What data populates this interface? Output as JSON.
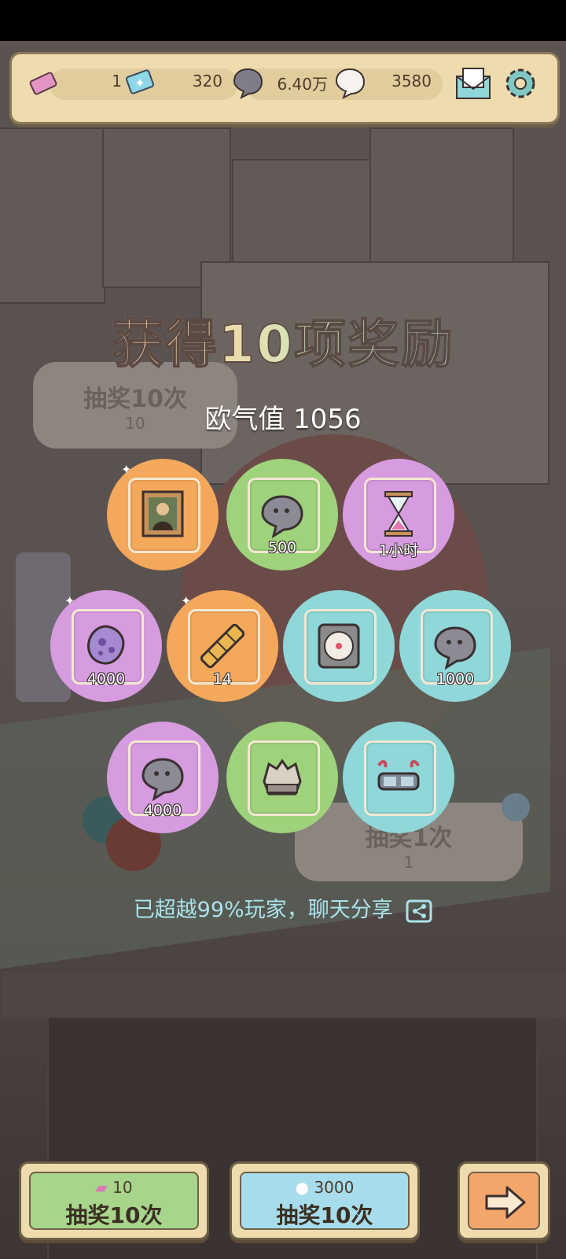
{
  "resources": {
    "tickets": "1",
    "gems": "320",
    "dark_bubbles": "6.40万",
    "white_bubbles": "3580"
  },
  "title": "获得10项奖励",
  "luck_text": "欧气值 1056",
  "share_text": "已超越99%玩家，聊天分享",
  "background": {
    "draw10_label": "抽奖10次",
    "draw10_cost": "10",
    "draw1_label": "抽奖1次",
    "draw1_cost": "1"
  },
  "rewards": [
    {
      "item": "mona-lisa-painting",
      "qty": "",
      "color": "orange"
    },
    {
      "item": "bubble",
      "qty": "500",
      "color": "green"
    },
    {
      "item": "hourglass",
      "qty": "1小时",
      "color": "purple"
    },
    {
      "item": "virus",
      "qty": "4000",
      "color": "purple"
    },
    {
      "item": "telescope",
      "qty": "14",
      "color": "orange"
    },
    {
      "item": "compass",
      "qty": "",
      "color": "teal"
    },
    {
      "item": "bubble",
      "qty": "1000",
      "color": "teal"
    },
    {
      "item": "bubble",
      "qty": "4000",
      "color": "purple"
    },
    {
      "item": "bone-fossil",
      "qty": "",
      "color": "green"
    },
    {
      "item": "glasses",
      "qty": "",
      "color": "teal"
    }
  ],
  "buttons": {
    "ticket_draw": {
      "cost": "10",
      "label": "抽奖10次"
    },
    "bubble_draw": {
      "cost": "3000",
      "label": "抽奖10次"
    }
  },
  "colors": {
    "orange": "#f4a85b",
    "green": "#9ed27b",
    "purple": "#d79be0",
    "teal": "#8fd7d8",
    "green_button": "#a7d58c",
    "blue_button": "#a6dcec",
    "orange_button": "#f3a66a"
  }
}
